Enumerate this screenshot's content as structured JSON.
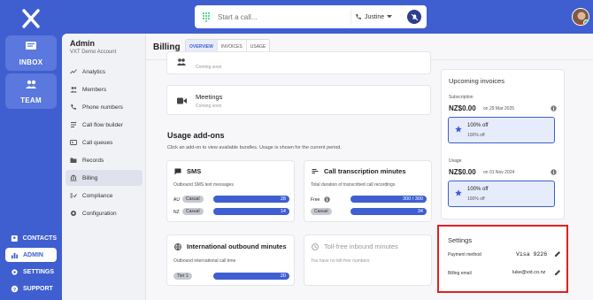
{
  "rail": {
    "inbox_label": "INBOX",
    "team_label": "TEAM",
    "contacts_label": "CONTACTS",
    "admin_label": "ADMIN",
    "settings_label": "SETTINGS",
    "support_label": "SUPPORT"
  },
  "callbar": {
    "placeholder": "Start a call...",
    "caller": "Justine"
  },
  "admin": {
    "title": "Admin",
    "account": "VXT Demo Account",
    "items": [
      {
        "label": "Analytics",
        "icon": "analytics-icon"
      },
      {
        "label": "Members",
        "icon": "members-icon"
      },
      {
        "label": "Phone numbers",
        "icon": "phone-icon"
      },
      {
        "label": "Call flow builder",
        "icon": "flow-icon"
      },
      {
        "label": "Call queues",
        "icon": "queue-icon"
      },
      {
        "label": "Records",
        "icon": "folder-icon"
      },
      {
        "label": "Billing",
        "icon": "bank-icon"
      },
      {
        "label": "Compliance",
        "icon": "compliance-icon"
      },
      {
        "label": "Configuration",
        "icon": "gear-icon"
      }
    ]
  },
  "billing": {
    "title": "Billing",
    "tabs": [
      "OVERVIEW",
      "INVOICES",
      "USAGE"
    ],
    "coming_soon": "Coming soon",
    "meetings_title": "Meetings",
    "meetings_status": "Coming soon",
    "usage_title": "Usage add-ons",
    "usage_desc": "Click an add-on to view available bundles. Usage is shown for the current period.",
    "sms": {
      "title": "SMS",
      "desc": "Outbound SMS text messages",
      "rows": [
        {
          "country": "AU",
          "tier": "Casual",
          "value": "28"
        },
        {
          "country": "NZ",
          "tier": "Casual",
          "value": "14"
        }
      ]
    },
    "transcription": {
      "title": "Call transcription minutes",
      "desc": "Total duration of transcribed call recordings",
      "free_label": "Free",
      "free_value": "300 / 300",
      "casual_label": "Casual",
      "casual_value": "34"
    },
    "intl": {
      "title": "International outbound minutes",
      "desc": "Outbound international call time",
      "tier": "Tier 1",
      "value": "20"
    },
    "tollfree": {
      "title": "Toll-free inbound minutes",
      "desc": "You have no toll-free numbers"
    }
  },
  "upcoming": {
    "title": "Upcoming invoices",
    "subscription": {
      "label": "Subscription",
      "amount": "NZ$0.00",
      "date": "on 29 Mar 2025",
      "discount": "100% off",
      "discount_sub": "100% off"
    },
    "usage": {
      "label": "Usage",
      "amount": "NZ$0.00",
      "date": "on 01 Nov 2024",
      "discount": "100% off",
      "discount_sub": "100% off"
    }
  },
  "settings": {
    "title": "Settings",
    "payment_label": "Payment method",
    "payment_value": "Visa 9226",
    "email_label": "Billing email",
    "email_value": "luke@vxt.co.nz"
  },
  "colors": {
    "brand": "#3f5fd0",
    "highlight": "#e02020"
  }
}
